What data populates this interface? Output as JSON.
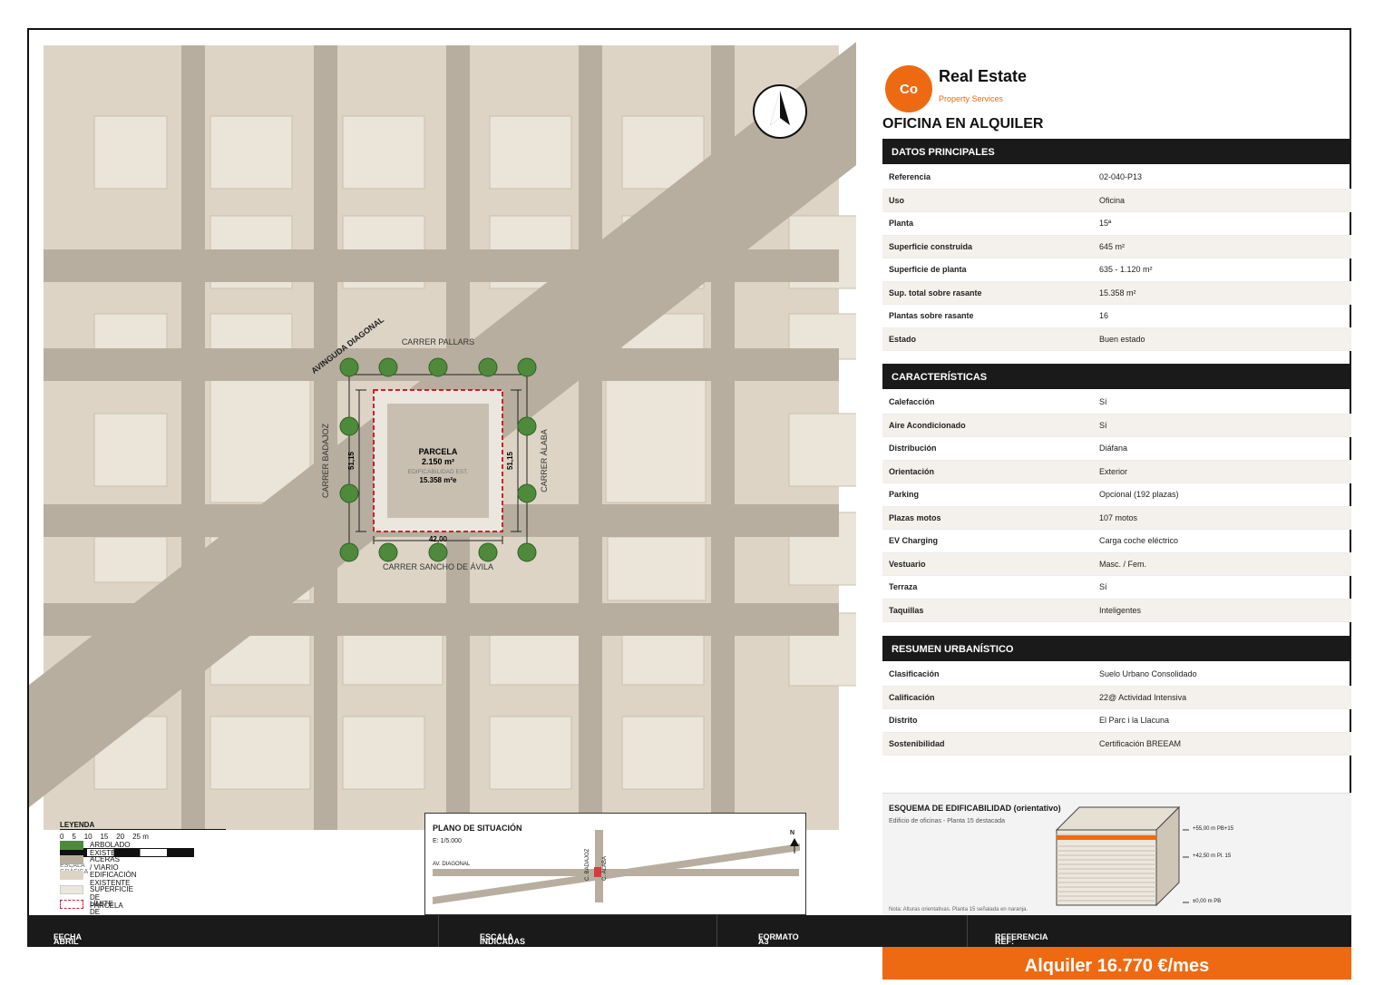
{
  "brand": {
    "logo": "Co",
    "name": "Real Estate",
    "tagline": "Property Services"
  },
  "title": "OFICINA EN ALQUILER",
  "map": {
    "streets": {
      "diagonal": "AVINGUDA DIAGONAL",
      "north": "CARRER PALLARS",
      "south": "CARRER SANCHO DE ÁVILA",
      "west": "CARRER BADAJOZ",
      "east": "CARRER ÁLABA"
    },
    "parcel": {
      "label": "PARCELA",
      "area": "2.150 m²",
      "edif_label": "EDIFICABILIDAD EST.",
      "edif_value": "15.358 m²e",
      "dim_side": "51,15",
      "dim_bottom": "42,00"
    },
    "north_icon": "north-arrow-icon"
  },
  "legend": {
    "title": "LEYENDA",
    "scale_ticks": [
      "0",
      "5",
      "10",
      "15",
      "20",
      "25 m"
    ],
    "scale_label": "ESCALA GRÁFICA",
    "items": [
      "ARBOLADO EXISTENTE",
      "ACERAS / VIARIO",
      "EDIFICACIÓN EXISTENTE",
      "SUPERFICIE DE PARCELA",
      "LÍMITE DE PARCELA"
    ],
    "colors": [
      "#4f8a3c",
      "#b7ae9f",
      "#ddd4c6",
      "#ece7de",
      "#c8232a"
    ]
  },
  "situacion": {
    "title": "PLANO DE SITUACIÓN",
    "scale": "E: 1/5.000",
    "diagonal": "AV. DIAGONAL",
    "badajoz": "C. BADAJOZ",
    "alaba": "C. ÁLABA",
    "north": "N"
  },
  "datos": {
    "heading": "DATOS PRINCIPALES",
    "rows": [
      {
        "k": "Referencia",
        "v": "02-040-P13"
      },
      {
        "k": "Uso",
        "v": "Oficina"
      },
      {
        "k": "Planta",
        "v": "15ª"
      },
      {
        "k": "Superficie construida",
        "v": "645 m²"
      },
      {
        "k": "Superficie de planta",
        "v": "635 - 1.120 m²"
      },
      {
        "k": "Sup. total sobre rasante",
        "v": "15.358 m²"
      },
      {
        "k": "Plantas sobre rasante",
        "v": "16"
      },
      {
        "k": "Estado",
        "v": "Buen estado"
      }
    ]
  },
  "caracteristicas": {
    "heading": "CARACTERÍSTICAS",
    "rows": [
      {
        "k": "Calefacción",
        "v": "Sí"
      },
      {
        "k": "Aire Acondicionado",
        "v": "Sí"
      },
      {
        "k": "Distribución",
        "v": "Diáfana"
      },
      {
        "k": "Orientación",
        "v": "Exterior"
      },
      {
        "k": "Parking",
        "v": "Opcional (192 plazas)"
      },
      {
        "k": "Plazas motos",
        "v": "107 motos"
      },
      {
        "k": "EV Charging",
        "v": "Carga coche eléctrico"
      },
      {
        "k": "Vestuario",
        "v": "Masc. / Fem."
      },
      {
        "k": "Terraza",
        "v": "Sí"
      },
      {
        "k": "Taquillas",
        "v": "Inteligentes"
      }
    ]
  },
  "urbanistico": {
    "heading": "RESUMEN URBANÍSTICO",
    "rows": [
      {
        "k": "Clasificación",
        "v": "Suelo Urbano Consolidado"
      },
      {
        "k": "Calificación",
        "v": "22@ Actividad Intensiva"
      },
      {
        "k": "Distrito",
        "v": "El Parc i la Llacuna"
      },
      {
        "k": "Sostenibilidad",
        "v": "Certificación BREEAM"
      }
    ]
  },
  "esquema": {
    "title": "ESQUEMA DE EDIFICABILIDAD (orientativo)",
    "subtitle": "Edificio de oficinas - Planta 15 destacada",
    "levels": [
      "+55,00 m  PB+15",
      "+42,50 m  Pl. 15",
      "±0,00 m  PB"
    ],
    "note": "Nota: Alturas orientativas. Planta 15 señalada en naranja."
  },
  "footer": {
    "fecha_label": "FECHA",
    "fecha": "ABRIL 2026",
    "escala_label": "ESCALA",
    "escala": "INDICADAS",
    "formato_label": "FORMATO",
    "formato": "A3",
    "referencia_label": "REFERENCIA",
    "referencia": "REF: 02-040-P13"
  },
  "price": "Alquiler  16.770 €/mes",
  "colors": {
    "accent": "#ee6a12",
    "dark": "#1a1a1a",
    "street": "#b7ae9f",
    "block": "#ddd4c6",
    "tree": "#4f8a3c",
    "limit": "#c8232a"
  }
}
